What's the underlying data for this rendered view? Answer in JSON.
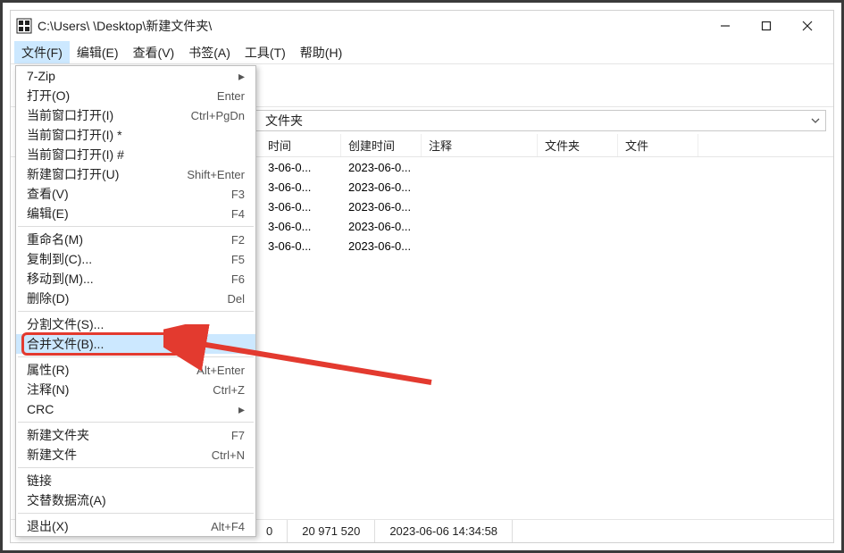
{
  "titlebar": {
    "path": "C:\\Users\\            \\Desktop\\新建文件夹\\"
  },
  "menubar": {
    "items": [
      {
        "label": "文件(F)",
        "active": true
      },
      {
        "label": "编辑(E)"
      },
      {
        "label": "查看(V)"
      },
      {
        "label": "书签(A)"
      },
      {
        "label": "工具(T)"
      },
      {
        "label": "帮助(H)"
      }
    ]
  },
  "pathbar": {
    "visible_suffix": "文件夹"
  },
  "headers": {
    "time1": "时间",
    "created": "创建时间",
    "comment": "注释",
    "folder": "文件夹",
    "file": "文件"
  },
  "rows": [
    {
      "t1": "3-06-0...",
      "t2": "2023-06-0..."
    },
    {
      "t1": "3-06-0...",
      "t2": "2023-06-0..."
    },
    {
      "t1": "3-06-0...",
      "t2": "2023-06-0..."
    },
    {
      "t1": "3-06-0...",
      "t2": "2023-06-0..."
    },
    {
      "t1": "3-06-0...",
      "t2": "2023-06-0..."
    }
  ],
  "statusbar": {
    "seg1": "0",
    "seg2": "20 971 520",
    "seg3": "2023-06-06 14:34:58"
  },
  "dropdown": {
    "items": [
      {
        "label": "7-Zip",
        "submenu": true
      },
      {
        "label": "打开(O)",
        "shortcut": "Enter"
      },
      {
        "label": "当前窗口打开(I)",
        "shortcut": "Ctrl+PgDn"
      },
      {
        "label": "当前窗口打开(I) *"
      },
      {
        "label": "当前窗口打开(I) #"
      },
      {
        "label": "新建窗口打开(U)",
        "shortcut": "Shift+Enter"
      },
      {
        "label": "查看(V)",
        "shortcut": "F3"
      },
      {
        "label": "编辑(E)",
        "shortcut": "F4"
      },
      {
        "sep": true
      },
      {
        "label": "重命名(M)",
        "shortcut": "F2"
      },
      {
        "label": "复制到(C)...",
        "shortcut": "F5"
      },
      {
        "label": "移动到(M)...",
        "shortcut": "F6"
      },
      {
        "label": "删除(D)",
        "shortcut": "Del"
      },
      {
        "sep": true
      },
      {
        "label": "分割文件(S)..."
      },
      {
        "label": "合并文件(B)...",
        "hover": true,
        "boxed": true
      },
      {
        "sep": true
      },
      {
        "label": "属性(R)",
        "shortcut": "Alt+Enter"
      },
      {
        "label": "注释(N)",
        "shortcut": "Ctrl+Z"
      },
      {
        "label": "CRC",
        "submenu": true
      },
      {
        "sep": true
      },
      {
        "label": "新建文件夹",
        "shortcut": "F7"
      },
      {
        "label": "新建文件",
        "shortcut": "Ctrl+N"
      },
      {
        "sep": true
      },
      {
        "label": "链接"
      },
      {
        "label": "交替数据流(A)"
      },
      {
        "sep": true
      },
      {
        "label": "退出(X)",
        "shortcut": "Alt+F4"
      }
    ]
  }
}
